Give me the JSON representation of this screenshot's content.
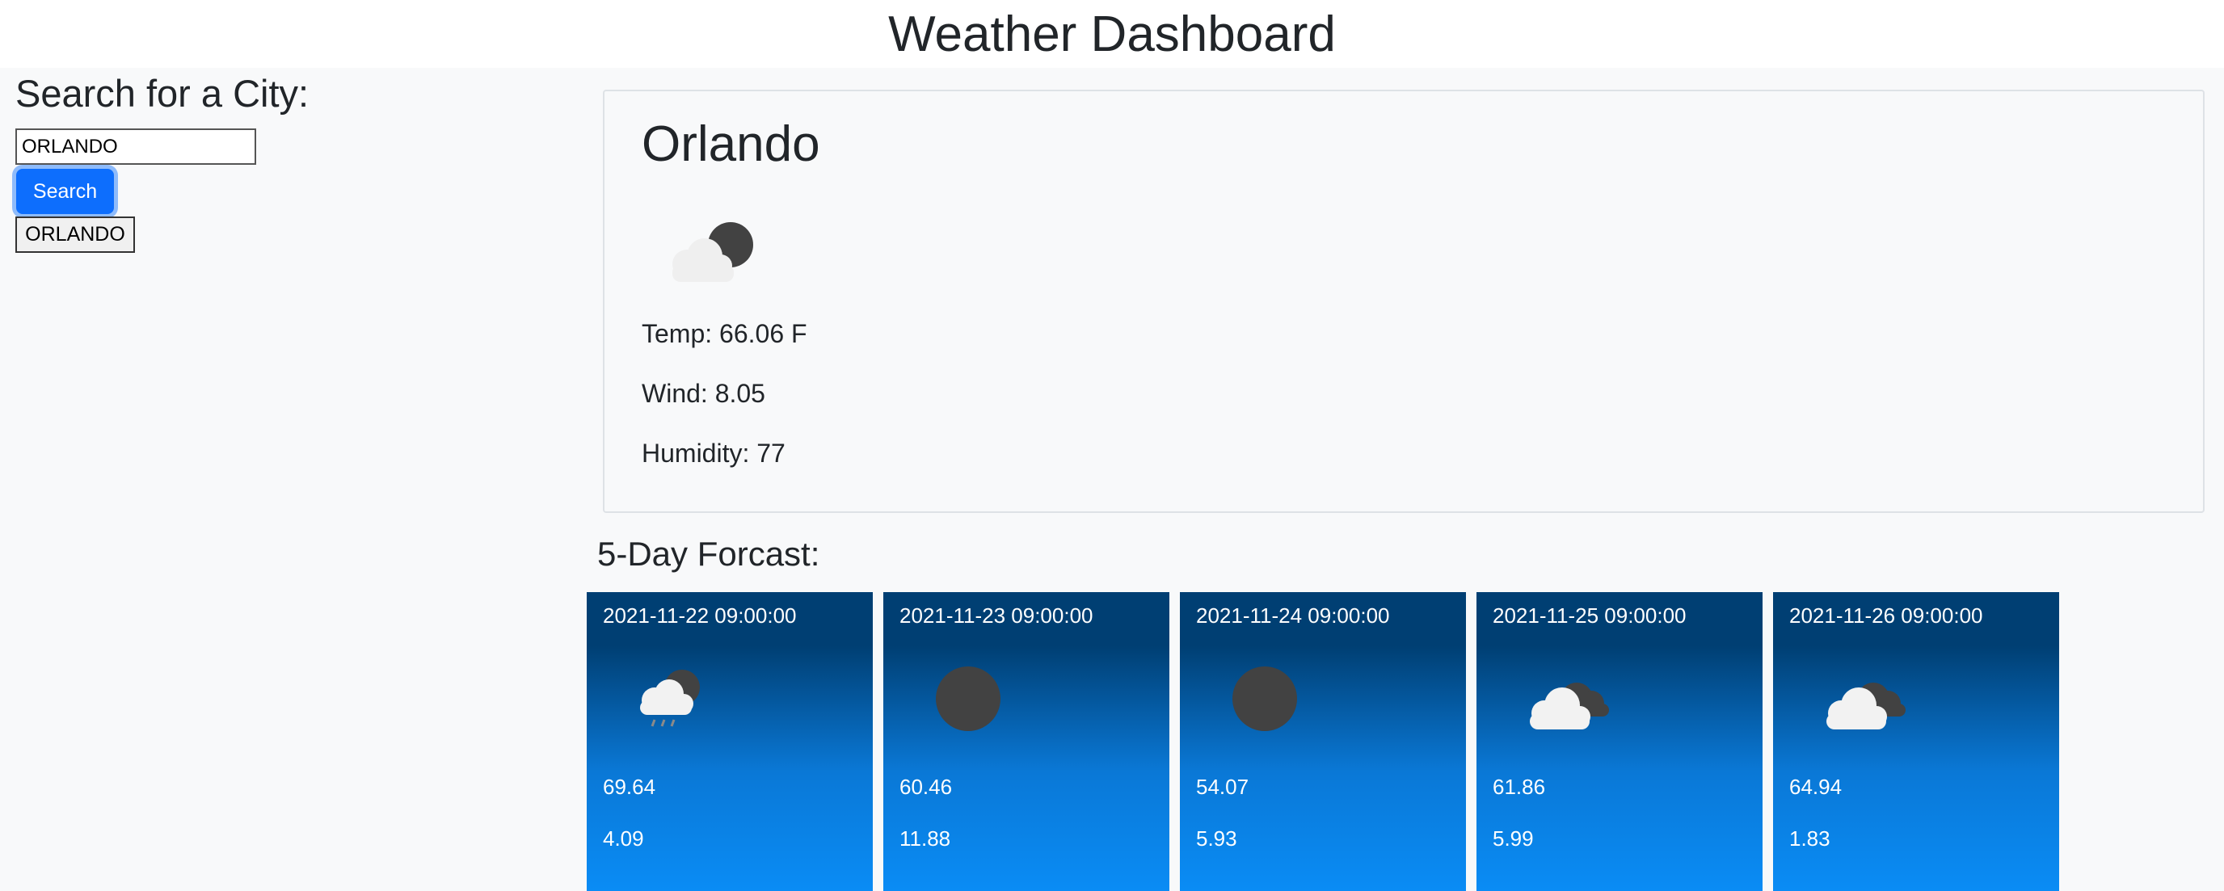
{
  "header": {
    "title": "Weather Dashboard"
  },
  "search": {
    "heading": "Search for a City:",
    "input_value": "ORLANDO",
    "button_label": "Search",
    "history": [
      "ORLANDO"
    ]
  },
  "current": {
    "city": "Orlando",
    "icon": "partly-cloudy-night-icon",
    "temp": "Temp: 66.06 F",
    "wind": "Wind: 8.05",
    "humidity": "Humidity: 77"
  },
  "forecast": {
    "heading": "5-Day Forcast:",
    "days": [
      {
        "date": "2021-11-22 09:00:00",
        "icon": "rain-cloud-night-icon",
        "temp": "69.64",
        "wind": "4.09"
      },
      {
        "date": "2021-11-23 09:00:00",
        "icon": "moon-icon",
        "temp": "60.46",
        "wind": "11.88"
      },
      {
        "date": "2021-11-24 09:00:00",
        "icon": "moon-icon",
        "temp": "54.07",
        "wind": "5.93"
      },
      {
        "date": "2021-11-25 09:00:00",
        "icon": "broken-clouds-icon",
        "temp": "61.86",
        "wind": "5.99"
      },
      {
        "date": "2021-11-26 09:00:00",
        "icon": "broken-clouds-icon",
        "temp": "64.94",
        "wind": "1.83"
      }
    ]
  }
}
